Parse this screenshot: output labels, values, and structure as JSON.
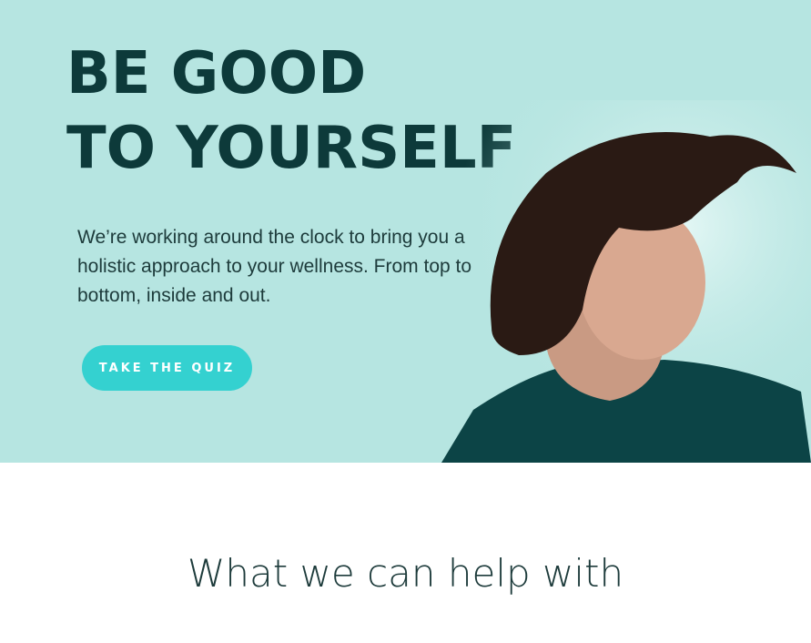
{
  "hero": {
    "title_line1": "BE GOOD",
    "title_line2": "TO YOURSELF",
    "description": "We’re working around the clock to bring you a holistic approach to your wellness. From top to bottom, inside and out.",
    "cta_label": "TAKE THE QUIZ",
    "image": "man-with-flowing-hair-photo"
  },
  "section": {
    "heading": "What we can help with"
  },
  "colors": {
    "hero_bg": "#b6e5e1",
    "accent": "#34d1d0",
    "text_dark": "#0d3a3a"
  }
}
